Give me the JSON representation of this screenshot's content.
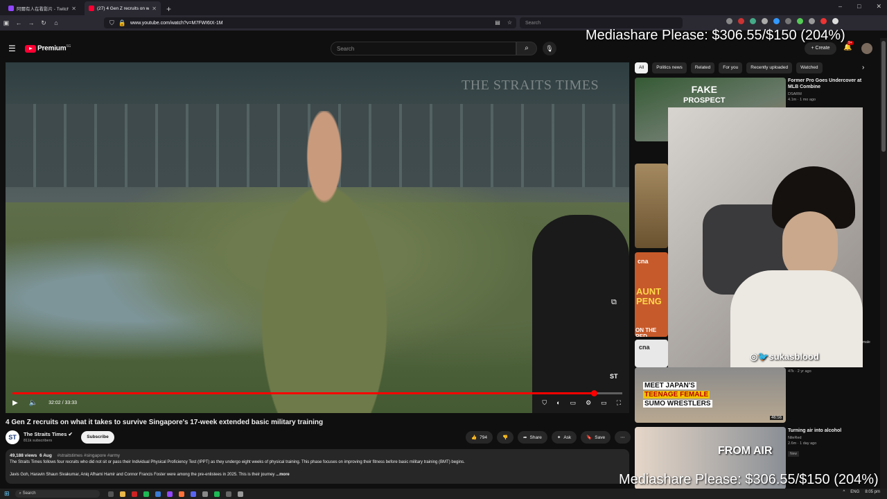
{
  "browser": {
    "tabs": [
      {
        "title": "阿爾有人在看影片 - Twitch",
        "favicon_color": "#9146ff",
        "active": false
      },
      {
        "title": "(27) 4 Gen Z recruits on what it",
        "favicon_color": "#ff0033",
        "active": true
      }
    ],
    "new_tab": "+",
    "url": "www.youtube.com/watch?v=M7FWI6tX-1M",
    "search_placeholder": "Search",
    "window_buttons": [
      "–",
      "□",
      "✕"
    ]
  },
  "youtube": {
    "logo_text": "Premium",
    "logo_region": "SG",
    "search_placeholder": "Search",
    "create_label": "Create",
    "notif_count": "9+",
    "video": {
      "watermark": "THE STRAITS TIMES",
      "corner_logo": "ST",
      "time": "32:02 / 33:33",
      "progress": 0.9538
    },
    "title": "4 Gen Z recruits on what it takes to survive Singapore's 17-week extended basic military training",
    "channel": {
      "name": "The Straits Times",
      "avatar_text": "ST",
      "subs": "811k subscribers",
      "subscribe_label": "Subscribe"
    },
    "actions": {
      "likes": "794",
      "share": "Share",
      "ask": "Ask",
      "save": "Save"
    },
    "description": {
      "views": "49,188 views",
      "date": "6 Aug",
      "tags": "#straitstimes #singapore #army",
      "line1": "The Straits Times follows four recruits who did not sit or pass their Individual Physical Proficiency Test (IPPT) as they undergo eight weeks of physical training. This phase focuses on improving their fitness before basic military training (BMT) begins.",
      "line2": "Javis Goh, Haravin Shaun Sivakumar, Aniq Afhami Hamir and Connor Francis Foster were among the pre-enlistees in 2025. This is their journey",
      "more": "...more"
    },
    "chips": [
      "All",
      "Politics news",
      "Related",
      "For you",
      "Recently uploaded",
      "Watched"
    ],
    "sidebar": [
      {
        "title": "Former Pro Goes Undercover at MLB Combine",
        "channel": "DSARM",
        "meta": "4.1m · 1 mo ago",
        "thumb_text1": "FAKE",
        "thumb_text2": "PROSPECT"
      },
      {
        "meta": "47k · 2 yr ago",
        "thumb_lines": [
          "MEET JAPAN'S",
          "TEENAGE FEMALE",
          "SUMO WRESTLERS"
        ],
        "duration": "46:56"
      },
      {
        "title": "Turning air into alcohol",
        "channel": "NileRed",
        "meta": "2.6m · 1 day ago",
        "badge": "New",
        "thumb_text": "FROM AIR"
      }
    ],
    "thumb_cna": "cna",
    "thumb_aunt": "AUNT PENG",
    "thumb_red": "ON THE RED",
    "edge_text_1": "as",
    "edge_text_2": "male"
  },
  "stream": {
    "mediashare_text": "Mediashare Please: $306.55/$150 (204%)",
    "cam_handle": "◎🐦sukasblood"
  },
  "taskbar": {
    "search": "Search",
    "lang": "ENG",
    "time": "8:05 pm"
  }
}
